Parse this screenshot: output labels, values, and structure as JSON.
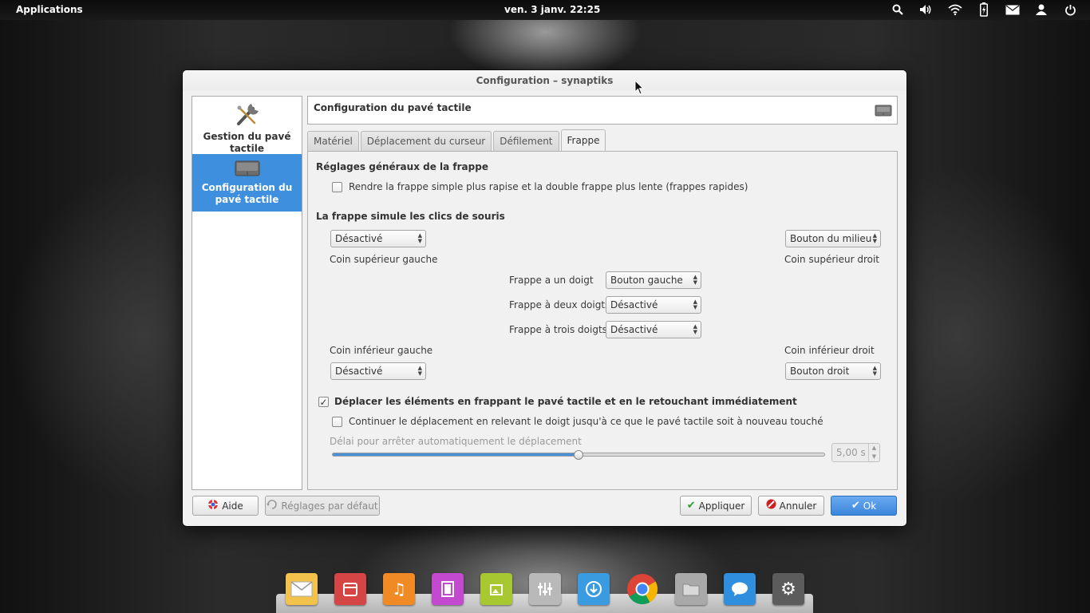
{
  "panel": {
    "applications": "Applications",
    "clock": "ven.  3 janv. 22:25",
    "indicators": [
      "search-icon",
      "volume-icon",
      "wifi-icon",
      "battery-icon",
      "mail-icon",
      "user-icon",
      "power-icon"
    ]
  },
  "window": {
    "title": "Configuration – synaptiks",
    "sidebar": [
      {
        "label": "Gestion du pavé tactile",
        "icon": "wrench-icon",
        "selected": false
      },
      {
        "label": "Configuration du pavé tactile",
        "icon": "touchpad-icon",
        "selected": true
      }
    ],
    "header_title": "Configuration du pavé tactile",
    "tabs": [
      {
        "label": "Matériel",
        "active": false
      },
      {
        "label": "Déplacement du curseur",
        "active": false
      },
      {
        "label": "Défilement",
        "active": false
      },
      {
        "label": "Frappe",
        "active": true
      }
    ],
    "general": {
      "title": "Réglages généraux de la frappe",
      "fast_taps_label": "Rendre la frappe simple plus rapise et la double frappe plus lente (frappes rapides)",
      "fast_taps_checked": false
    },
    "clicks": {
      "title": "La frappe simule les clics de souris",
      "top_left_value": "Désactivé",
      "top_left_label": "Coin supérieur gauche",
      "top_right_value": "Bouton du milieu",
      "top_right_label": "Coin supérieur droit",
      "one_finger_label": "Frappe a un doigt",
      "one_finger_value": "Bouton gauche",
      "two_finger_label": "Frappe à deux doigts",
      "two_finger_value": "Désactivé",
      "three_finger_label": "Frappe à trois doigts",
      "three_finger_value": "Désactivé",
      "bottom_left_label": "Coin inférieur gauche",
      "bottom_left_value": "Désactivé",
      "bottom_right_label": "Coin inférieur droit",
      "bottom_right_value": "Bouton droit"
    },
    "drag": {
      "label": "Déplacer les éléments en frappant le pavé tactile et en le retouchant immédiatement",
      "checked": true,
      "continue_label": "Continuer le déplacement en relevant le doigt jusqu'à ce que le pavé tactile soit à nouveau touché",
      "continue_checked": false,
      "delay_label": "Délai pour arrêter automatiquement le déplacement",
      "delay_value": "5,00 s",
      "slider_fraction": 0.5
    },
    "buttons": {
      "help": "Aide",
      "defaults": "Réglages par défaut",
      "apply": "Appliquer",
      "cancel": "Annuler",
      "ok": "Ok"
    }
  },
  "dock": [
    {
      "name": "mail-icon",
      "color": "#f3c24a"
    },
    {
      "name": "calendar-icon",
      "color": "#d64545"
    },
    {
      "name": "music-icon",
      "color": "#f08a24"
    },
    {
      "name": "video-icon",
      "color": "#c34ad0"
    },
    {
      "name": "photos-icon",
      "color": "#a8c832"
    },
    {
      "name": "mixer-icon",
      "color": "#b9b9b9"
    },
    {
      "name": "download-icon",
      "color": "#3b9be0"
    },
    {
      "name": "chrome-icon",
      "color": "#ffffff"
    },
    {
      "name": "files-icon",
      "color": "#a9a9a9"
    },
    {
      "name": "chat-icon",
      "color": "#2f8fde"
    },
    {
      "name": "settings-icon",
      "color": "#5c5c5c"
    }
  ],
  "colors": {
    "accent": "#3e8fde"
  }
}
